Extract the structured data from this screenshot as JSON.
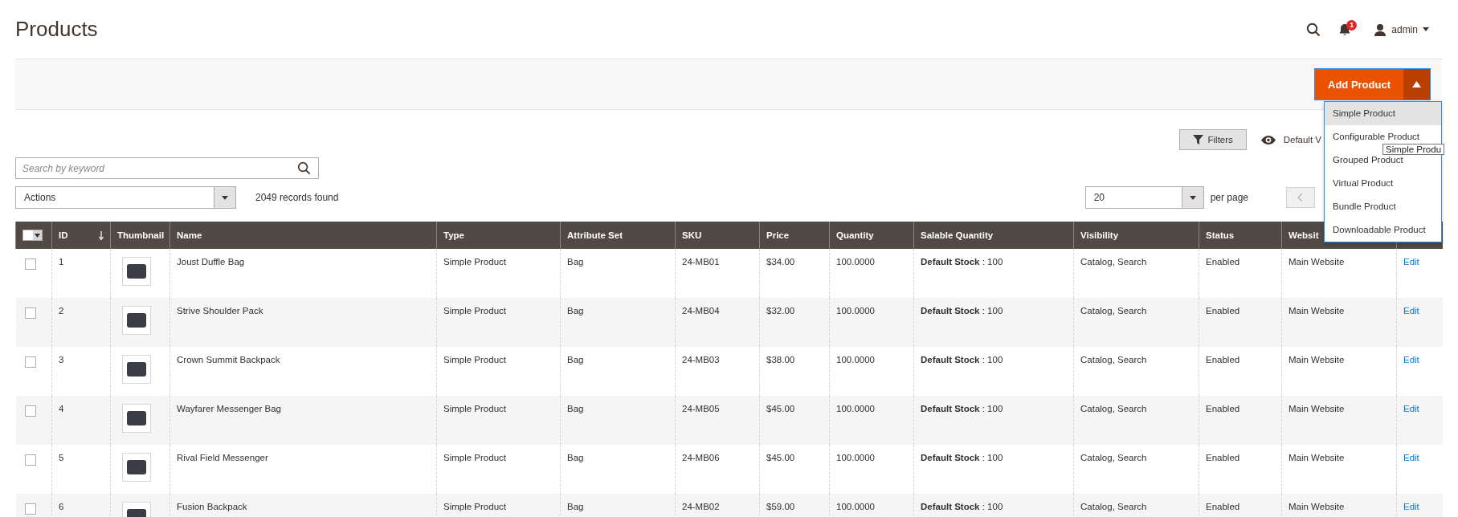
{
  "header": {
    "title": "Products",
    "notification_count": "1",
    "user": "admin"
  },
  "action_bar": {
    "add_button": "Add Product",
    "menu_open": true,
    "menu": [
      {
        "label": "Simple Product",
        "selected": true
      },
      {
        "label": "Configurable Product",
        "selected": false
      },
      {
        "label": "Grouped Product",
        "selected": false
      },
      {
        "label": "Virtual Product",
        "selected": false
      },
      {
        "label": "Bundle Product",
        "selected": false
      },
      {
        "label": "Downloadable Product",
        "selected": false
      }
    ],
    "tooltip": "Simple Produ"
  },
  "toolbar": {
    "filters": "Filters",
    "view": "Default V",
    "search": {
      "placeholder": "Search by keyword"
    },
    "actions": "Actions",
    "records": "2049 records found",
    "per_page": "20",
    "per_page_label": "per page"
  },
  "table": {
    "mass_select_checked": false,
    "columns": [
      "ID",
      "Thumbnail",
      "Name",
      "Type",
      "Attribute Set",
      "SKU",
      "Price",
      "Quantity",
      "Salable Quantity",
      "Visibility",
      "Status",
      "Websit"
    ],
    "rows": [
      {
        "checked": false,
        "cells": [
          "1",
          "",
          "Joust Duffle Bag",
          "Simple Product",
          "Bag",
          "24-MB01",
          "$34.00",
          "100.0000",
          "**Default Stock** : 100",
          "Catalog, Search",
          "Enabled",
          "Main Website"
        ],
        "action": "Edit"
      },
      {
        "checked": false,
        "cells": [
          "2",
          "",
          "Strive Shoulder Pack",
          "Simple Product",
          "Bag",
          "24-MB04",
          "$32.00",
          "100.0000",
          "**Default Stock** : 100",
          "Catalog, Search",
          "Enabled",
          "Main Website"
        ],
        "action": "Edit"
      },
      {
        "checked": false,
        "cells": [
          "3",
          "",
          "Crown Summit Backpack",
          "Simple Product",
          "Bag",
          "24-MB03",
          "$38.00",
          "100.0000",
          "**Default Stock** : 100",
          "Catalog, Search",
          "Enabled",
          "Main Website"
        ],
        "action": "Edit"
      },
      {
        "checked": false,
        "cells": [
          "4",
          "",
          "Wayfarer Messenger Bag",
          "Simple Product",
          "Bag",
          "24-MB05",
          "$45.00",
          "100.0000",
          "**Default Stock** : 100",
          "Catalog, Search",
          "Enabled",
          "Main Website"
        ],
        "action": "Edit"
      },
      {
        "checked": false,
        "cells": [
          "5",
          "",
          "Rival Field Messenger",
          "Simple Product",
          "Bag",
          "24-MB06",
          "$45.00",
          "100.0000",
          "**Default Stock** : 100",
          "Catalog, Search",
          "Enabled",
          "Main Website"
        ],
        "action": "Edit"
      },
      {
        "checked": false,
        "cells": [
          "6",
          "",
          "Fusion Backpack",
          "Simple Product",
          "Bag",
          "24-MB02",
          "$59.00",
          "100.0000",
          "**Default Stock** : 100",
          "Catalog, Search",
          "Enabled",
          "Main Website"
        ],
        "action": "Edit"
      }
    ]
  }
}
